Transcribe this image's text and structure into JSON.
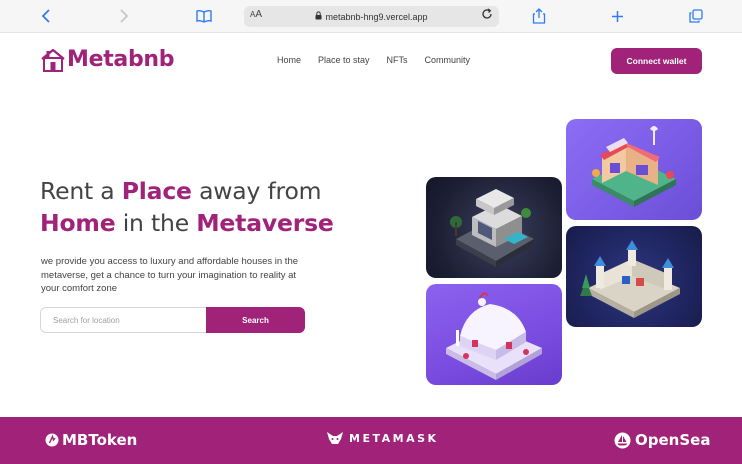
{
  "browser": {
    "back_icon": "chevron-left-icon",
    "forward_icon": "chevron-right-icon",
    "reader_icon": "book-icon",
    "aa_small": "A",
    "aa_big": "A",
    "url": "metabnb-hng9.vercel.app",
    "lock_icon": "lock-icon",
    "reload_icon": "reload-icon",
    "share_icon": "share-icon",
    "newtab_icon": "plus-icon",
    "tabs_icon": "tabs-icon"
  },
  "header": {
    "logo_text": "Metabnb",
    "nav": [
      "Home",
      "Place to stay",
      "NFTs",
      "Community"
    ],
    "connect_wallet": "Connect wallet"
  },
  "hero": {
    "title_part1": "Rent a ",
    "title_highlight1": "Place",
    "title_part2": " away from ",
    "title_highlight2": "Home",
    "title_part3": " in the ",
    "title_highlight3": "Metaverse",
    "description": "we provide you access to luxury and affordable houses in the metaverse, get a chance to turn your imagination to reality at your comfort zone",
    "search_placeholder": "Search for location",
    "search_button": "Search"
  },
  "gallery": {
    "tiles": [
      "house",
      "market",
      "castle",
      "snow-house"
    ]
  },
  "partners": {
    "mbtoken": "MBToken",
    "metamask": "METAMASK",
    "opensea": "OpenSea"
  },
  "colors": {
    "brand": "#a02279",
    "text": "#434343",
    "safari_blue": "#2f7cf6"
  }
}
